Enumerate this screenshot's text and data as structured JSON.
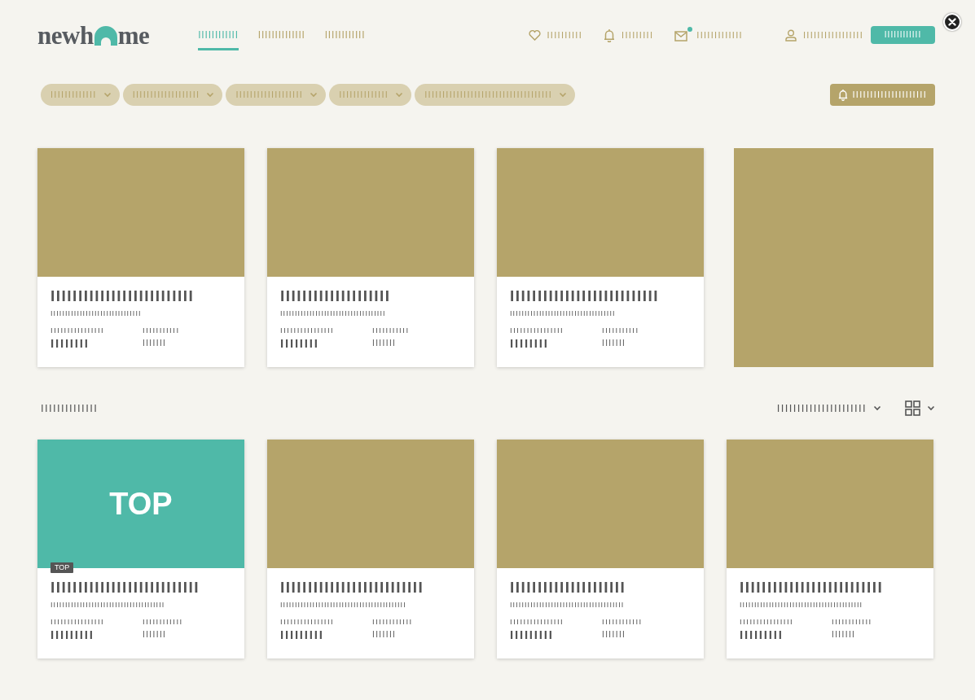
{
  "logo": {
    "before": "newh",
    "after": "me"
  },
  "nav_tabs": [
    {
      "label": "IIIIIIIIIIII",
      "selected": true
    },
    {
      "label": "IIIIIIIIIIIIII",
      "selected": false
    },
    {
      "label": "IIIIIIIIIIII",
      "selected": false
    }
  ],
  "header_links": [
    {
      "kind": "favorites",
      "label": "IIIIIIIIII",
      "unread": false
    },
    {
      "kind": "alerts",
      "label": "IIIIIIIII",
      "unread": false
    },
    {
      "kind": "messages",
      "label": "IIIIIIIIIIIII",
      "unread": true
    },
    {
      "kind": "account",
      "label": "IIIIIIIIIIIIIIIII",
      "unread": false
    }
  ],
  "register_button": "IIIIIIIIIIII",
  "filters": [
    {
      "label": "IIIIIIIIIIIII"
    },
    {
      "label": "IIIIIIIIIIIIIIIIIII"
    },
    {
      "label": "IIIIIIIIIIIIIIIIIII"
    },
    {
      "label": "IIIIIIIIIIIIII"
    },
    {
      "label": "IIIIIIIIIIIIIIIIIIIIIIIIIIIIIIIIIIII"
    }
  ],
  "alert_button": "IIIIIIIIIIIIIIIIIIIII",
  "featured": [
    {
      "kind": "listing",
      "title": "IIIIIIIIIIIIIIIIIIIIIIIIII",
      "subtitle": "IIIIIIIIIIIIIIIIIIIIIIIIIIIIIII",
      "label_1": "IIIIIIIIIIIIIIII",
      "value_1": "IIIIIIII",
      "label_2": "IIIIIIIIIII",
      "value_2": "IIIIIII"
    },
    {
      "kind": "listing",
      "title": "IIIIIIIIIIIIIIIIIIII",
      "subtitle": "IIIIIIIIIIIIIIIIIIIIIIIIIIIIIIIIIIII",
      "label_1": "IIIIIIIIIIIIIIII",
      "value_1": "IIIIIIII",
      "label_2": "IIIIIIIIIII",
      "value_2": "IIIIIII"
    },
    {
      "kind": "listing",
      "title": "IIIIIIIIIIIIIIIIIIIIIIIIIII",
      "subtitle": "IIIIIIIIIIIIIIIIIIIIIIIIIIIIIIIIIIII",
      "label_1": "IIIIIIIIIIIIIIII",
      "value_1": "IIIIIIII",
      "label_2": "IIIIIIIIIII",
      "value_2": "IIIIIII"
    },
    {
      "kind": "ad"
    }
  ],
  "results_label": "IIIIIIIIIIIIII",
  "sort_label": "IIIIIIIIIIIIIIIIIIIIII",
  "listings": [
    {
      "top": true,
      "image_text": "TOP",
      "badge": "TOP",
      "title": "IIIIIIIIIIIIIIIIIIIIIIIIIII",
      "subtitle": "IIIIIIIIIIIIIIIIIIIIIIIIIIIIIIIIIIIIIII",
      "label_1": "IIIIIIIIIIIIIIII",
      "value_1": "IIIIIIIII",
      "label_2": "IIIIIIIIIIII",
      "value_2": "IIIIIII"
    },
    {
      "top": false,
      "title": "IIIIIIIIIIIIIIIIIIIIIIIIII",
      "subtitle": "IIIIIIIIIIIIIIIIIIIIIIIIIIIIIIIIIIIIIIIIIII",
      "label_1": "IIIIIIIIIIIIIIII",
      "value_1": "IIIIIIIII",
      "label_2": "IIIIIIIIIIII",
      "value_2": "IIIIIII"
    },
    {
      "top": false,
      "title": "IIIIIIIIIIIIIIIIIIIII",
      "subtitle": "IIIIIIIIIIIIIIIIIIIIIIIIIIIIIIIIIIIIIII",
      "label_1": "IIIIIIIIIIIIIIII",
      "value_1": "IIIIIIIII",
      "label_2": "IIIIIIIIIIII",
      "value_2": "IIIIIII"
    },
    {
      "top": false,
      "title": "IIIIIIIIIIIIIIIIIIIIIIIIII",
      "subtitle": "IIIIIIIIIIIIIIIIIIIIIIIIIIIIIIIIIIIIIIIIII",
      "label_1": "IIIIIIIIIIIIIIII",
      "value_1": "IIIIIIIII",
      "label_2": "IIIIIIIIIIII",
      "value_2": "IIIIIII"
    }
  ]
}
